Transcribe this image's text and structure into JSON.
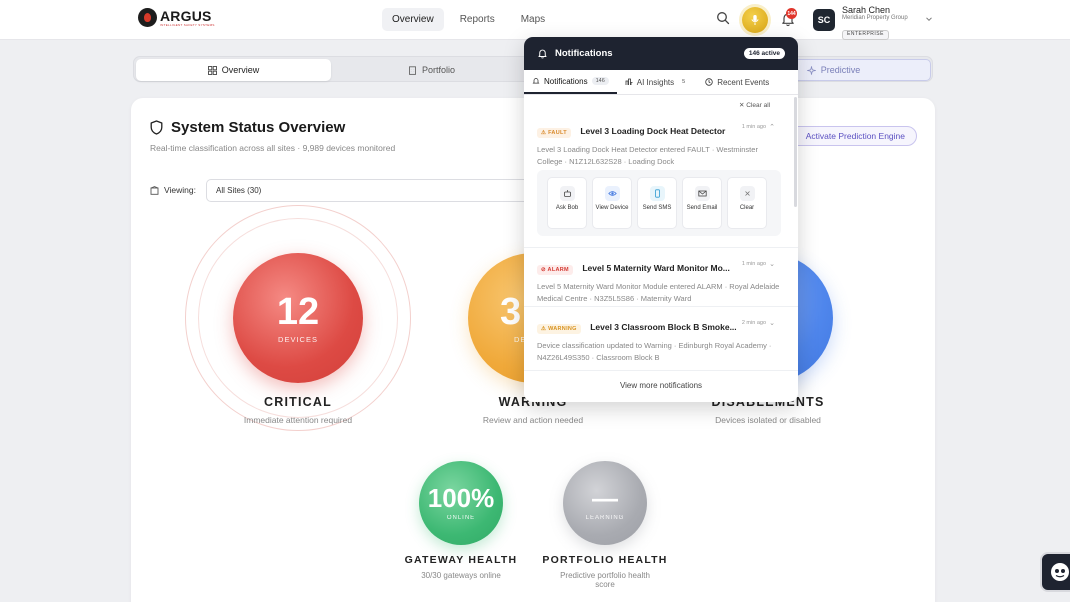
{
  "header": {
    "logo_text": "ARGUS",
    "logo_tagline": "INTELLIGENT SAFETY SYSTEMS",
    "nav": [
      {
        "label": "Overview",
        "active": true
      },
      {
        "label": "Reports",
        "active": false
      },
      {
        "label": "Maps",
        "active": false
      }
    ],
    "notification_badge": "144",
    "user": {
      "initials": "SC",
      "name": "Sarah Chen",
      "org": "Meridian Property Group",
      "plan": "ENTERPRISE"
    }
  },
  "segments": [
    {
      "label": "Overview",
      "icon": "grid-icon",
      "active": true
    },
    {
      "label": "Portfolio",
      "icon": "building-icon",
      "active": false
    },
    {
      "label": "Predictive",
      "icon": "sparkle-icon",
      "active": false
    }
  ],
  "system": {
    "title": "System Status Overview",
    "subtitle": "Real-time classification across all sites · 9,989 devices monitored",
    "activate_label": "Activate Prediction Engine",
    "viewing_label": "Viewing:",
    "viewing_value": "All Sites (30)"
  },
  "metrics": {
    "critical": {
      "value": "12",
      "unit": "DEVICES",
      "title": "CRITICAL",
      "subtitle": "Immediate attention required",
      "color": "#e04a44"
    },
    "warning": {
      "value": "3",
      "unit": "DE",
      "title": "WARNING",
      "subtitle": "Review and action needed",
      "color": "#f0a93a"
    },
    "disablements": {
      "title": "DISABLEMENTS",
      "subtitle": "Devices isolated or disabled",
      "color": "#4f86ec"
    },
    "gateway": {
      "value": "100%",
      "unit": "ONLINE",
      "title": "GATEWAY HEALTH",
      "subtitle": "30/30 gateways online",
      "color": "#3db873"
    },
    "portfolio": {
      "value": "—",
      "unit": "LEARNING",
      "title": "PORTFOLIO HEALTH",
      "subtitle_line1": "Predictive portfolio health",
      "subtitle_line2": "score",
      "color": "#a9abb1"
    }
  },
  "notifications": {
    "title": "Notifications",
    "active_count": "146 active",
    "tabs": [
      {
        "label": "Notifications",
        "badge": "146",
        "active": true
      },
      {
        "label": "AI Insights",
        "badge": "5",
        "active": false
      },
      {
        "label": "Recent Events",
        "badge": "",
        "active": false
      }
    ],
    "clear_all": "Clear all",
    "items": [
      {
        "tag": "FAULT",
        "title": "Level 3 Loading Dock Heat Detector",
        "time": "1 min ago",
        "desc": "Level 3 Loading Dock Heat Detector entered FAULT · Westminster College · N1Z12L632S28 · Loading Dock"
      },
      {
        "tag": "ALARM",
        "title": "Level 5 Maternity Ward Monitor Mo...",
        "time": "1 min ago",
        "desc": "Level 5 Maternity Ward Monitor Module entered ALARM · Royal Adelaide Medical Centre · N3Z5L5S86 · Maternity Ward"
      },
      {
        "tag": "WARNING",
        "title": "Level 3 Classroom Block B Smoke...",
        "time": "2 min ago",
        "desc": "Device classification updated to Warning · Edinburgh Royal Academy · N4Z26L49S350 · Classroom Block B"
      }
    ],
    "actions": [
      {
        "label": "Ask Bob",
        "icon": "robot-icon"
      },
      {
        "label": "View Device",
        "icon": "eye-icon"
      },
      {
        "label": "Send SMS",
        "icon": "phone-icon"
      },
      {
        "label": "Send Email",
        "icon": "mail-icon"
      },
      {
        "label": "Clear",
        "icon": "close-icon"
      }
    ],
    "view_more": "View more notifications"
  }
}
